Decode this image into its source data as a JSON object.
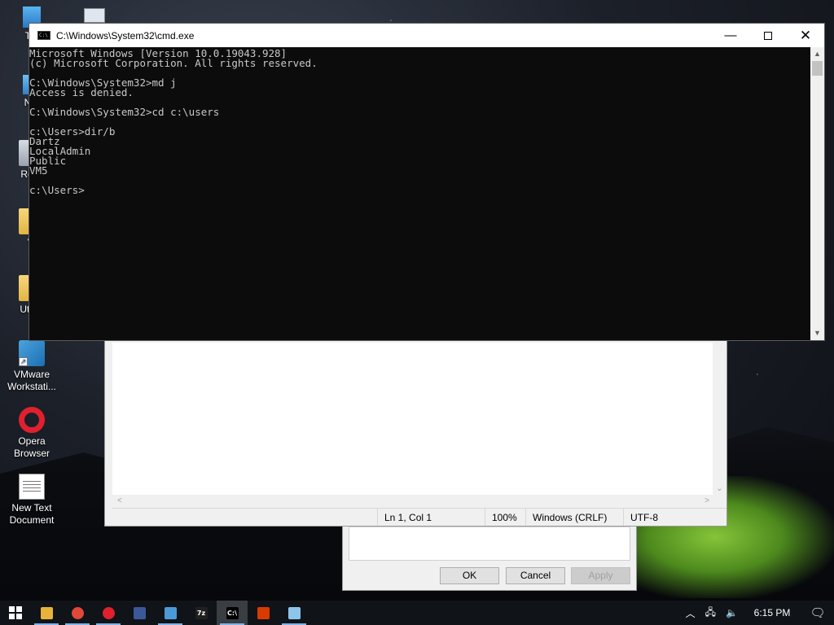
{
  "desktop": {
    "icons": [
      {
        "label": "Thi",
        "icon": "this-pc-icon"
      },
      {
        "label": "Net",
        "icon": "network-icon"
      },
      {
        "label": "Recy",
        "icon": "recycle-bin-icon"
      },
      {
        "label": "Vi",
        "icon": "folder-icon"
      },
      {
        "label": "Utility",
        "icon": "folder-icon"
      },
      {
        "label": "VMware Workstati...",
        "icon": "vmware-icon"
      },
      {
        "label": "Opera Browser",
        "icon": "opera-icon"
      },
      {
        "label": "New Text Document",
        "icon": "text-document-icon"
      }
    ]
  },
  "cmd": {
    "title": "C:\\Windows\\System32\\cmd.exe",
    "lines": [
      "Microsoft Windows [Version 10.0.19043.928]",
      "(c) Microsoft Corporation. All rights reserved.",
      "",
      "C:\\Windows\\System32>md j",
      "Access is denied.",
      "",
      "C:\\Windows\\System32>cd c:\\users",
      "",
      "c:\\Users>dir/b",
      "Dartz",
      "LocalAdmin",
      "Public",
      "VM5",
      "",
      "c:\\Users>"
    ]
  },
  "notepad": {
    "status": {
      "position": "Ln 1, Col 1",
      "zoom": "100%",
      "line_ending": "Windows (CRLF)",
      "encoding": "UTF-8"
    }
  },
  "dialog": {
    "ok": "OK",
    "cancel": "Cancel",
    "apply": "Apply"
  },
  "taskbar": {
    "time": "6:15 PM",
    "apps": [
      {
        "name": "file-explorer-icon",
        "color": "#e8b33a"
      },
      {
        "name": "chrome-icon",
        "color": "#e0483a"
      },
      {
        "name": "opera-icon",
        "color": "#e0202e"
      },
      {
        "name": "facebook-icon",
        "color": "#3b5998"
      },
      {
        "name": "control-panel-icon",
        "color": "#4b9ad8"
      },
      {
        "name": "7zip-icon",
        "color": "#202020",
        "text": "7z"
      },
      {
        "name": "cmd-icon",
        "color": "#000000",
        "text": "C:\\"
      },
      {
        "name": "office-icon",
        "color": "#d83b01"
      },
      {
        "name": "notepad-icon",
        "color": "#8ec6ea"
      }
    ]
  }
}
